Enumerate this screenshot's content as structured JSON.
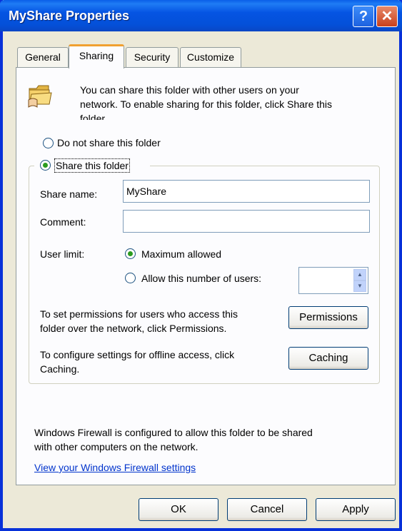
{
  "window": {
    "title": "MyShare Properties",
    "help_glyph": "?",
    "close_glyph": "✕"
  },
  "tabs": [
    {
      "label": "General",
      "active": false
    },
    {
      "label": "Sharing",
      "active": true
    },
    {
      "label": "Security",
      "active": false
    },
    {
      "label": "Customize",
      "active": false
    }
  ],
  "sharing": {
    "intro_line1": "You can share this folder with other users on your",
    "intro_line2": "network.  To enable sharing for this folder, click Share this",
    "intro_line3": "folder.",
    "do_not_share_label": "Do not share this folder",
    "share_label": "Share this folder",
    "selected_option": "share",
    "share_name_label": "Share name:",
    "share_name_value": "MyShare",
    "comment_label": "Comment:",
    "comment_value": "",
    "user_limit_label": "User limit:",
    "maximum_allowed_label": "Maximum allowed",
    "allow_users_label": "Allow this number of users:",
    "user_limit_selected": "maximum",
    "allow_users_value": "",
    "permissions_text_line1": "To set permissions for users who access this",
    "permissions_text_line2": "folder over the network, click Permissions.",
    "permissions_button": "Permissions",
    "caching_text_line1": "To configure settings for offline access, click",
    "caching_text_line2": "Caching.",
    "caching_button": "Caching",
    "firewall_text_line1": "Windows Firewall is configured to allow this folder to be shared",
    "firewall_text_line2": "with other computers on the network.",
    "firewall_link": "View your Windows Firewall settings"
  },
  "buttons": {
    "ok": "OK",
    "cancel": "Cancel",
    "apply": "Apply"
  },
  "colors": {
    "title_bar": "#0554e3",
    "dialog_bg": "#ece9d8",
    "link": "#0033cc",
    "active_tab_accent": "#f0a030"
  },
  "icons": {
    "folder": "shared-folder-icon",
    "help": "help-icon",
    "close": "close-icon"
  }
}
